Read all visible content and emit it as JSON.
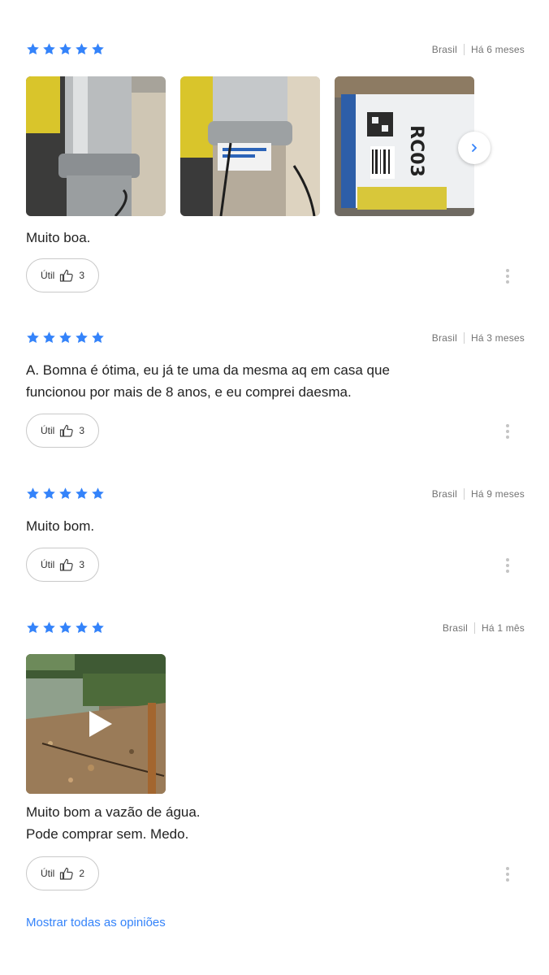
{
  "colors": {
    "star": "#3483fa",
    "link": "#3483fa",
    "meta": "#737373"
  },
  "reviews": [
    {
      "rating": 5,
      "country": "Brasil",
      "date": "Há 6 meses",
      "text_lines": [
        "Muito boa."
      ],
      "util_label": "Útil",
      "util_count": "3",
      "photos": [
        "valve-closeup-photo",
        "valve-label-photo",
        "box-rc03-photo"
      ]
    },
    {
      "rating": 5,
      "country": "Brasil",
      "date": "Há 3 meses",
      "text_lines": [
        "A. Bomna é ótima, eu já te uma da mesma aq em casa que",
        "funcionou por mais de 8 anos, e eu comprei daesma."
      ],
      "util_label": "Útil",
      "util_count": "3"
    },
    {
      "rating": 5,
      "country": "Brasil",
      "date": "Há 9 meses",
      "text_lines": [
        "Muito bom."
      ],
      "util_label": "Útil",
      "util_count": "3"
    },
    {
      "rating": 5,
      "country": "Brasil",
      "date": "Há 1 mês",
      "text_lines": [
        "Muito bom a vazão de água.",
        "Pode comprar sem. Medo."
      ],
      "util_label": "Útil",
      "util_count": "2",
      "photos": [
        "river-video-thumbnail"
      ]
    }
  ],
  "photo_text": {
    "box_code": "RC03"
  },
  "icons": {
    "star": "star-icon",
    "thumbs_up": "thumbs-up-icon",
    "more": "more-vertical-icon",
    "next": "chevron-right-icon",
    "play": "play-icon"
  },
  "show_all_label": "Mostrar todas as opiniões"
}
